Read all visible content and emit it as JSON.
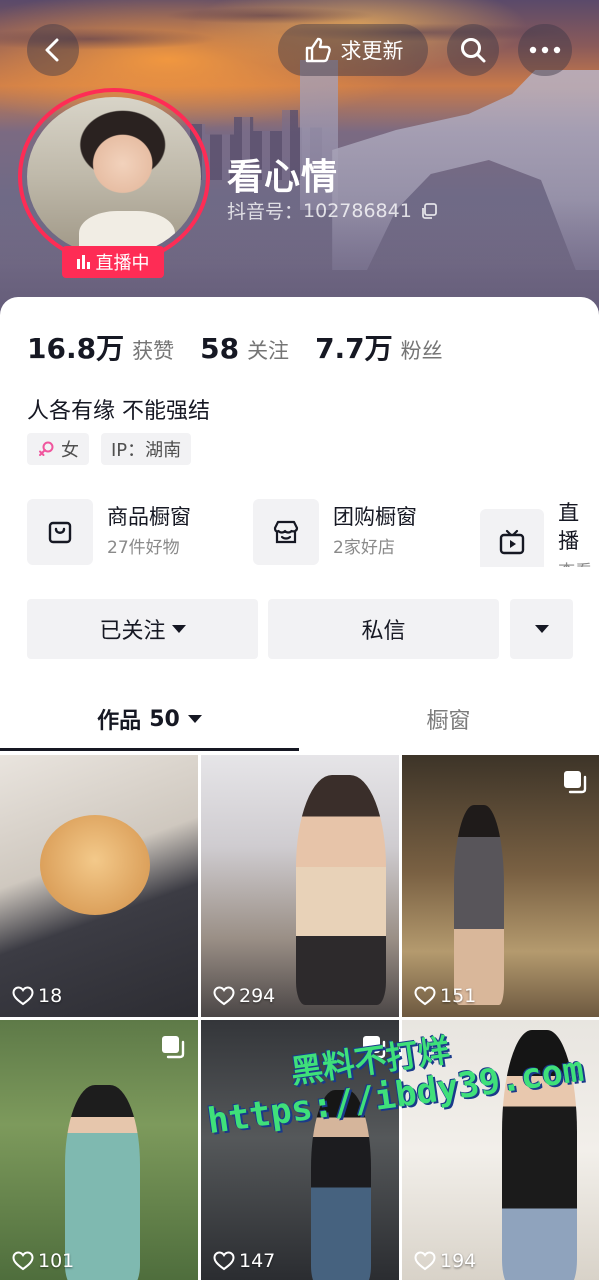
{
  "header": {
    "update_label": "求更新",
    "nickname": "看心情",
    "douyin_id_label": "抖音号：",
    "douyin_id": "102786841",
    "live_label": "直播中"
  },
  "stats": [
    {
      "value": "16.8万",
      "label": "获赞"
    },
    {
      "value": "58",
      "label": "关注"
    },
    {
      "value": "7.7万",
      "label": "粉丝"
    }
  ],
  "bio": "人各有缘 不能强结",
  "tags": {
    "gender": "女",
    "ip": "IP：湖南"
  },
  "services": [
    {
      "title": "商品橱窗",
      "sub": "27件好物",
      "icon": "bag-icon"
    },
    {
      "title": "团购橱窗",
      "sub": "2家好店",
      "icon": "store-icon"
    },
    {
      "title": "直播",
      "sub": "查看",
      "icon": "tv-icon"
    }
  ],
  "actions": {
    "follow_label": "已关注",
    "message_label": "私信"
  },
  "tabs": {
    "works_label": "作品",
    "works_count": "50",
    "window_label": "橱窗"
  },
  "posts": [
    {
      "likes": "18",
      "multi": false
    },
    {
      "likes": "294",
      "multi": false
    },
    {
      "likes": "151",
      "multi": true
    },
    {
      "likes": "101",
      "multi": true
    },
    {
      "likes": "147",
      "multi": true
    },
    {
      "likes": "194",
      "multi": false
    }
  ],
  "watermark": {
    "line1": "黑料不打烊",
    "line2": "https://ibdy39.com"
  },
  "colors": {
    "accent": "#fe2c55",
    "button_bg": "#f2f2f4",
    "female": "#f0559d"
  }
}
